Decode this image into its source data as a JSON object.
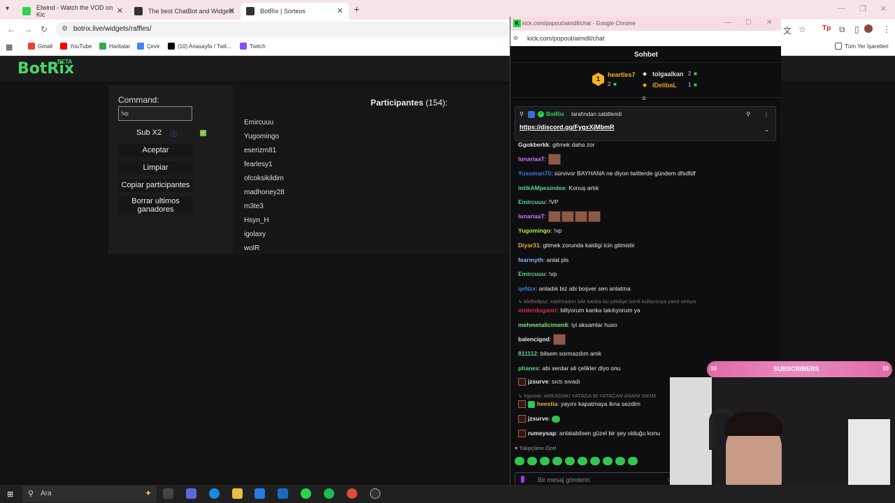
{
  "browser": {
    "tabs": [
      {
        "title": "Elwind - Watch the VOD on Kic",
        "color": "#2bd44f"
      },
      {
        "title": "The best ChatBot and Widgets",
        "color": "#333333"
      },
      {
        "title": "BotRix | Sorteos",
        "color": "#333333"
      }
    ],
    "url": "botrix.live/widgets/raffles/",
    "bookmarks": [
      {
        "label": "Gmail",
        "color": "#ea4335"
      },
      {
        "label": "YouTube",
        "color": "#ff0000"
      },
      {
        "label": "Haritalar",
        "color": "#34a853"
      },
      {
        "label": "Çevir",
        "color": "#4285f4"
      },
      {
        "label": "(10) Anasayfa / Twit...",
        "color": "#000000"
      },
      {
        "label": "Twitch",
        "color": "#9146ff"
      }
    ],
    "all_bookmarks": "Tüm Yer İşaretleri"
  },
  "botrix": {
    "logo": "BotRix",
    "beta": "BETA",
    "command_label": "Command:",
    "command_value": "!vp",
    "sub_label": "Sub X2",
    "buttons": {
      "accept": "Aceptar",
      "clear": "Limpiar",
      "copy": "Copiar participantes",
      "delete_last": "Borrar ultimos ganadores"
    },
    "participants_label": "Participantes",
    "participants_count": "(154):",
    "participants": [
      "Emircuuu",
      "Yugomingo",
      "eserizm81",
      "fearlesy1",
      "ofcoksikildim",
      "madhoney28",
      "m3te3",
      "Hsyn_H",
      "igolaxy",
      "wolR"
    ]
  },
  "kick": {
    "window_title": "kick.com/popout/aimdll/chat - Google Chrome",
    "url": "kick.com/popout/aimdll/chat",
    "chat_title": "Sohbet",
    "leaderboard": [
      {
        "name": "heartles7",
        "count": "2",
        "color": "#f2b321"
      },
      {
        "name": "tolgaalkan",
        "count": "2",
        "color": "#dddddd"
      },
      {
        "name": "IDelibaL",
        "count": "1",
        "color": "#e8a020"
      }
    ],
    "pinned": {
      "by_user": "BotRix",
      "by_text": "tarafından sabitlendi",
      "link": "https://discord.gg/FygxXjMbmR"
    },
    "messages": [
      {
        "user": "Ggokberkk",
        "color": "#e8e8e8",
        "text": " gitmek daha zor",
        "emotes": 0
      },
      {
        "user": "lunariaaT",
        "color": "#c77dff",
        "text": "",
        "emotes": 1
      },
      {
        "user": "Yusoman70",
        "color": "#3a7bd5",
        "text": " sürvivor BAYHANA ne diyon twitterde gündem dfsdfdf",
        "emotes": 0
      },
      {
        "user": "intikAMpesindee",
        "color": "#5bd48a",
        "text": " Konuş artık",
        "emotes": 0
      },
      {
        "user": "Emircuuu",
        "color": "#5bd48a",
        "text": " !VP",
        "emotes": 0
      },
      {
        "user": "lunariaaT",
        "color": "#c77dff",
        "text": "",
        "emotes": 4
      },
      {
        "user": "Yugomingo",
        "color": "#b8f03a",
        "text": " !vp",
        "emotes": 0
      },
      {
        "user": "Diyar31",
        "color": "#f0b042",
        "text": " gitmek zorunda kaldigi icin gitmistir",
        "emotes": 0
      },
      {
        "user": "fearmyth",
        "color": "#8fb4ff",
        "text": " anlat pls",
        "emotes": 0
      },
      {
        "user": "Emircuuu",
        "color": "#5bd48a",
        "text": " !vp",
        "emotes": 0
      },
      {
        "user": "qeNzx",
        "color": "#3a7bd5",
        "text": " anladık biz abi boşver sen anlatma",
        "emotes": 0
      }
    ],
    "reply1": "klothofpsz: katılmadım bile kanka bu çekilişe isimli kullanıcıya yanıt veriyor",
    "messages2": [
      {
        "user": "onderdoganrr",
        "color": "#e0304a",
        "text": " biliyorum kanka takılıyorum ya",
        "emotes": 0
      },
      {
        "user": "mehmetalicimen6",
        "color": "#7be87b",
        "text": " iyi aksamlar huso",
        "emotes": 0
      },
      {
        "user": "balencigod",
        "color": "#e8e8e8",
        "text": "",
        "emotes": 1
      },
      {
        "user": "811112",
        "color": "#5bd48a",
        "text": " bilsem sormazdım amk",
        "emotes": 0
      },
      {
        "user": "phanex",
        "color": "#5bd48a",
        "text": " abi serdar ali çelikler diyo onu",
        "emotes": 0
      },
      {
        "user": "jzsurve",
        "color": "#e8e8e8",
        "text": " sıctı sıvadı",
        "emotes": 0
      }
    ],
    "reply2": "kgortak: ARKADAKI YATAGA BI YATACAN ANANI SIKIM",
    "messages3": [
      {
        "user": "heestia",
        "color": "#f0b042",
        "text": " yayını kapatmaya ikna sezdim"
      },
      {
        "user": "jzsurve",
        "color": "#e8e8e8",
        "text": ""
      },
      {
        "user": "rumeysap",
        "color": "#e8e8e8",
        "text": " anlatabilsen güzel bir şey olduğu konu"
      }
    ],
    "follower_only": "Takipçilere Özel",
    "input_placeholder": "Bir mesaj gönderin"
  },
  "overlay": {
    "subs_left": "10",
    "subs_label": "SUBSCRIBERS",
    "subs_right": "10"
  },
  "taskbar": {
    "search_label": "Ara"
  }
}
